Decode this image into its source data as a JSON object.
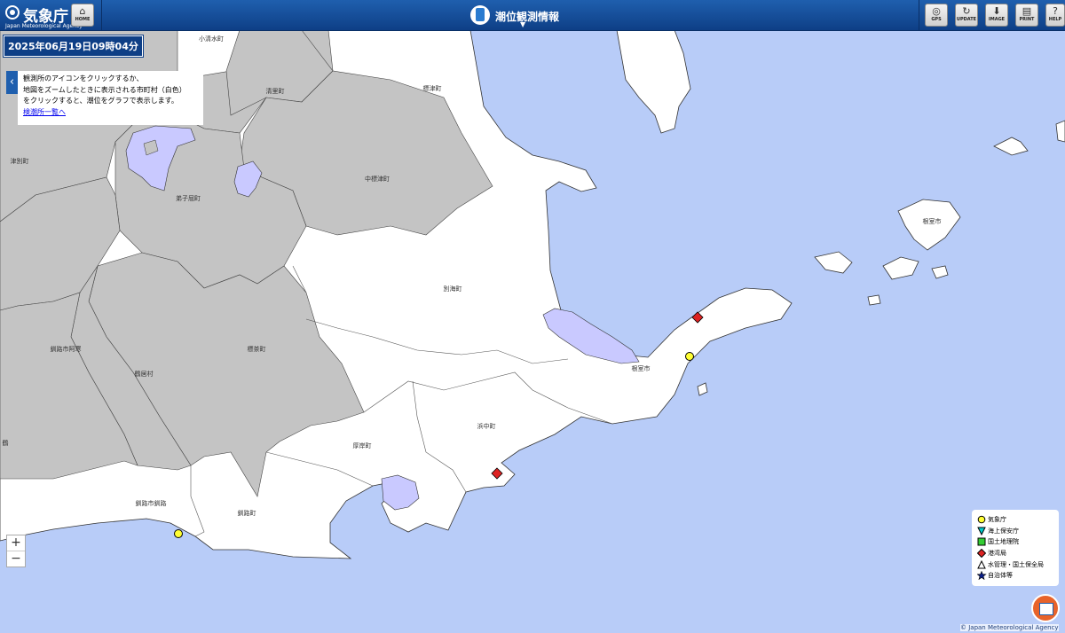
{
  "header": {
    "logo_jp": "気象庁",
    "logo_en": "Japan Meteorological Agency",
    "home_label": "HOME",
    "page_title": "潮位観測情報",
    "buttons": [
      {
        "label": "GPS",
        "icon": "gps-icon"
      },
      {
        "label": "UPDATE",
        "icon": "update-icon"
      },
      {
        "label": "IMAGE",
        "icon": "download-icon"
      },
      {
        "label": "PRINT",
        "icon": "print-icon"
      },
      {
        "label": "HELP",
        "icon": "help-icon"
      }
    ]
  },
  "datetime": "2025年06月19日09時04分",
  "info_panel": {
    "line1": "観測所のアイコンをクリックするか、",
    "line2": "地図をズームしたときに表示される市町村（白色）",
    "line3": "をクリックすると、潮位をグラフで表示します。",
    "link": "検潮所一覧へ"
  },
  "zoom": {
    "in": "+",
    "out": "−"
  },
  "map_labels": {
    "koshimizu": "小清水町",
    "kiyosato": "清里町",
    "shibetsu": "標津町",
    "nakashibetsu": "中標津町",
    "teshikaga": "弟子屈町",
    "tsubetsu": "津別町",
    "betsukai": "別海町",
    "shibecha": "標茶町",
    "kushiro_akan": "釧路市阿寒",
    "tsurui": "鶴居村",
    "nemuro": "根室市",
    "nemuro_island": "根室市",
    "hamanaka": "浜中町",
    "akkeshi": "厚岸町",
    "kushiro_town": "釧路町",
    "kushiro_city": "釧路市釧路",
    "edge": "鶴"
  },
  "legend": {
    "items": [
      {
        "label": "気象庁",
        "color": "#ffff33",
        "shape": "circle"
      },
      {
        "label": "海上保安庁",
        "color": "#00cccc",
        "shape": "triangle-down"
      },
      {
        "label": "国土地理院",
        "color": "#33cc33",
        "shape": "square"
      },
      {
        "label": "港湾局",
        "color": "#dd2222",
        "shape": "diamond"
      },
      {
        "label": "水管理・国土保全局",
        "color": "#ffffff",
        "shape": "triangle-up"
      },
      {
        "label": "自治体等",
        "color": "#0a1f8a",
        "shape": "star"
      }
    ]
  },
  "copyright": "© Japan Meteorological Agency",
  "colors": {
    "sea": "#b8ccf8",
    "land_white": "#ffffff",
    "land_gray": "#c4c4c4",
    "lake": "#c9c9ff",
    "header": "#1f5fae"
  }
}
